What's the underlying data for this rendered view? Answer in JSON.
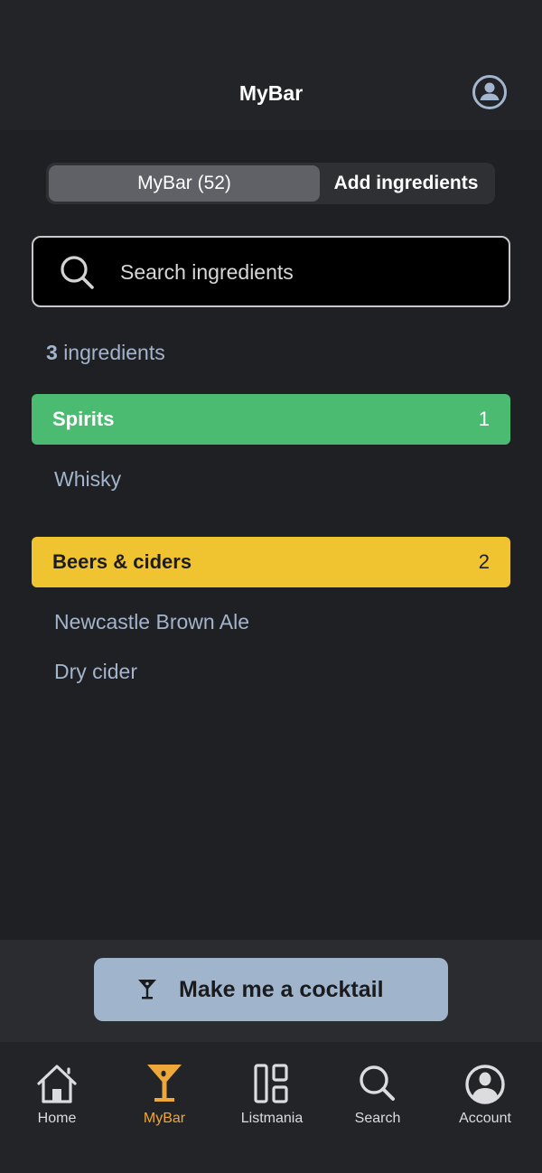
{
  "header": {
    "title": "MyBar",
    "account_icon": "account-circle-icon"
  },
  "segmented": {
    "tabs": [
      {
        "label": "MyBar (52)",
        "active": true
      },
      {
        "label": "Add ingredients",
        "active": false
      }
    ]
  },
  "search": {
    "icon": "search-icon",
    "placeholder": "Search ingredients",
    "value": ""
  },
  "summary": {
    "count": "3",
    "label": "ingredients"
  },
  "categories": [
    {
      "name": "Spirits",
      "count": "1",
      "color": "#4bbb71",
      "items": [
        "Whisky"
      ]
    },
    {
      "name": "Beers & ciders",
      "count": "2",
      "color": "#efc430",
      "items": [
        "Newcastle Brown Ale",
        "Dry cider"
      ]
    }
  ],
  "cta": {
    "label": "Make me a cocktail",
    "icon": "cocktail-glass-icon"
  },
  "tabbar": {
    "active_color": "#eea83a",
    "tabs": [
      {
        "label": "Home",
        "icon": "home-icon"
      },
      {
        "label": "MyBar",
        "icon": "cocktail-glass-icon",
        "active": true
      },
      {
        "label": "Listmania",
        "icon": "grid-layout-icon"
      },
      {
        "label": "Search",
        "icon": "search-icon"
      },
      {
        "label": "Account",
        "icon": "account-circle-icon"
      }
    ]
  }
}
